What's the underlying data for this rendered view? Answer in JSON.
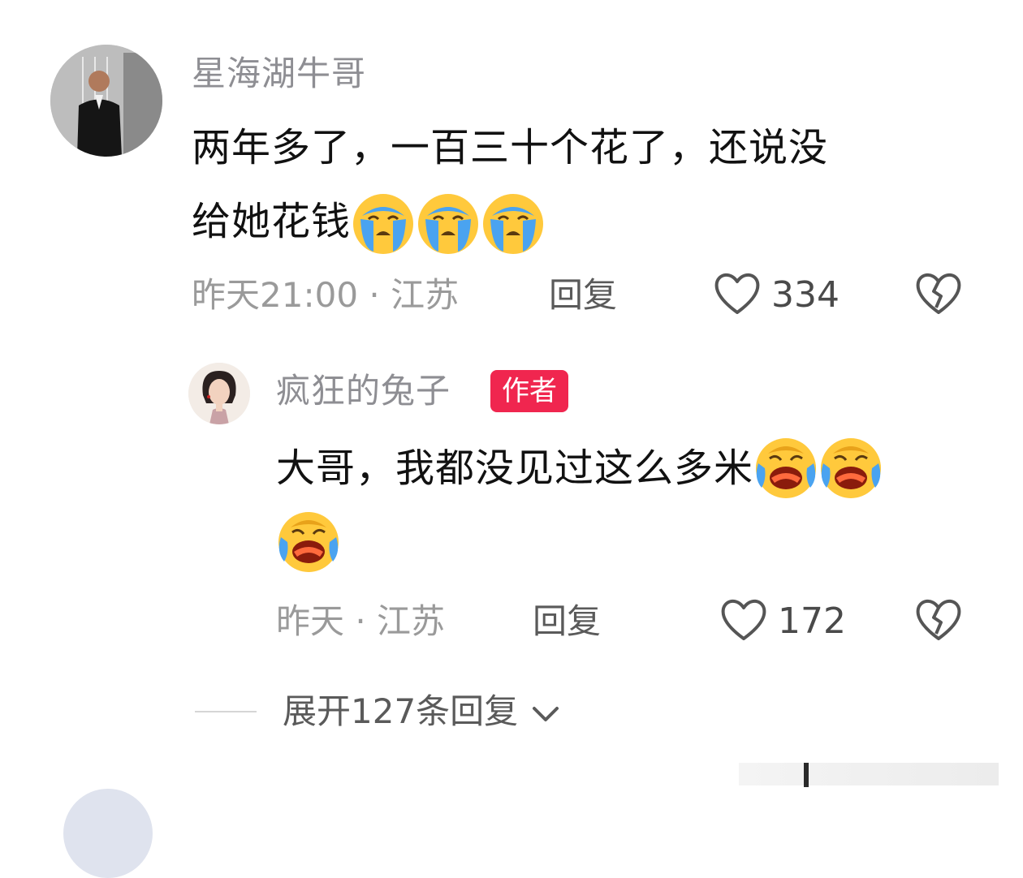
{
  "comment": {
    "username": "星海湖牛哥",
    "text_line1": "两年多了，一百三十个花了，还说没",
    "text_line2": "给她花钱",
    "emojis": [
      "loudly-crying-icon",
      "loudly-crying-icon",
      "loudly-crying-icon"
    ],
    "time_location": "昨天21:00 · 江苏",
    "reply_label": "回复",
    "likes": "334"
  },
  "reply": {
    "username": "疯狂的兔子",
    "badge": "作者",
    "text_line1": "大哥，我都没见过这么多米",
    "emojis": [
      "laughing-crying-icon",
      "laughing-crying-icon",
      "laughing-crying-icon"
    ],
    "time_location": "昨天 · 江苏",
    "reply_label": "回复",
    "likes": "172"
  },
  "expand_label": "展开127条回复",
  "colors": {
    "badge": "#f0264f",
    "emoji_yellow": "#ffc93c",
    "tears": "#4aa3f0"
  }
}
